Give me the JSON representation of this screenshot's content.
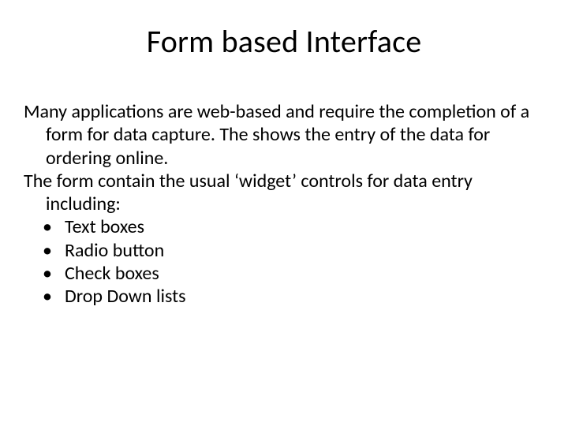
{
  "title": "Form based Interface",
  "para1": "Many applications are web-based and require the completion of a form for data capture. The shows the entry of the data for ordering online.",
  "para2": "The form contain the usual ‘widget’ controls for data entry including:",
  "bullets": {
    "0": "Text boxes",
    "1": "Radio button",
    "2": "Check boxes",
    "3": "Drop Down lists"
  }
}
